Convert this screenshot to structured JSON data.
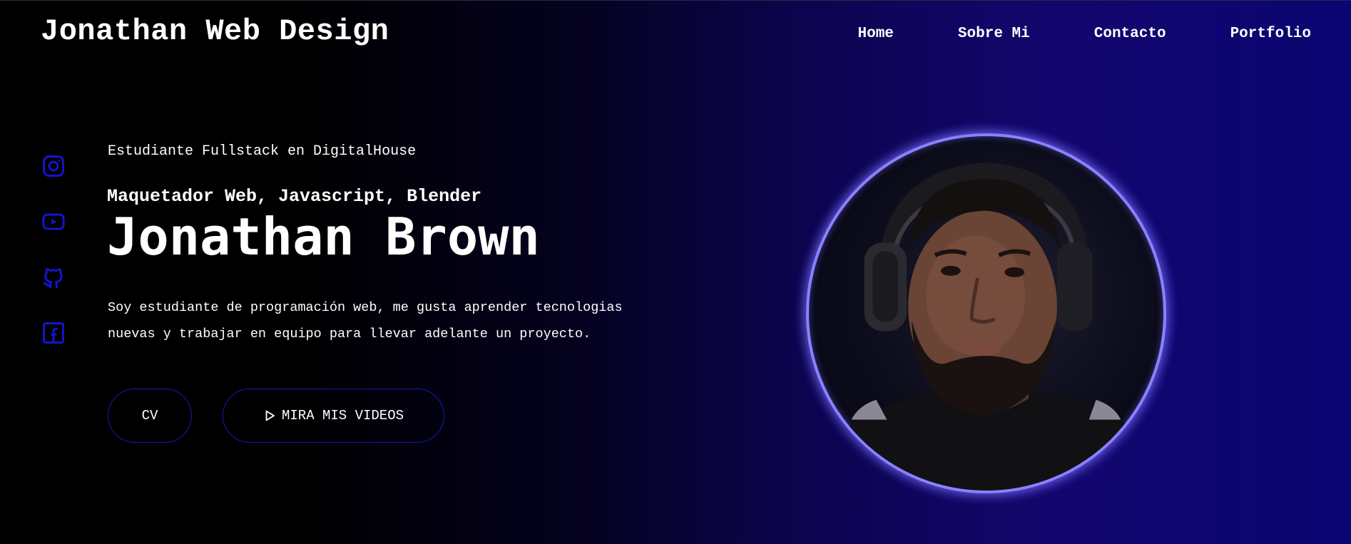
{
  "header": {
    "logo": "Jonathan Web Design",
    "nav": [
      "Home",
      "Sobre Mi",
      "Contacto",
      "Portfolio"
    ]
  },
  "social": [
    {
      "icon": "instagram-icon"
    },
    {
      "icon": "youtube-icon"
    },
    {
      "icon": "github-icon"
    },
    {
      "icon": "facebook-icon"
    }
  ],
  "hero": {
    "subtitle": "Estudiante Fullstack en DigitalHouse",
    "role": "Maquetador Web, Javascript, Blender",
    "name": "Jonathan Brown",
    "description_line1": "Soy estudiante de programación web, me gusta aprender tecnologias",
    "description_line2": "nuevas y trabajar en equipo para llevar adelante un proyecto.",
    "cv_button": "CV",
    "videos_button": "MIRA MIS VIDEOS"
  },
  "colors": {
    "accent": "#1414d8",
    "avatar_ring": "#8a82ff",
    "background_end": "#0a0672"
  }
}
